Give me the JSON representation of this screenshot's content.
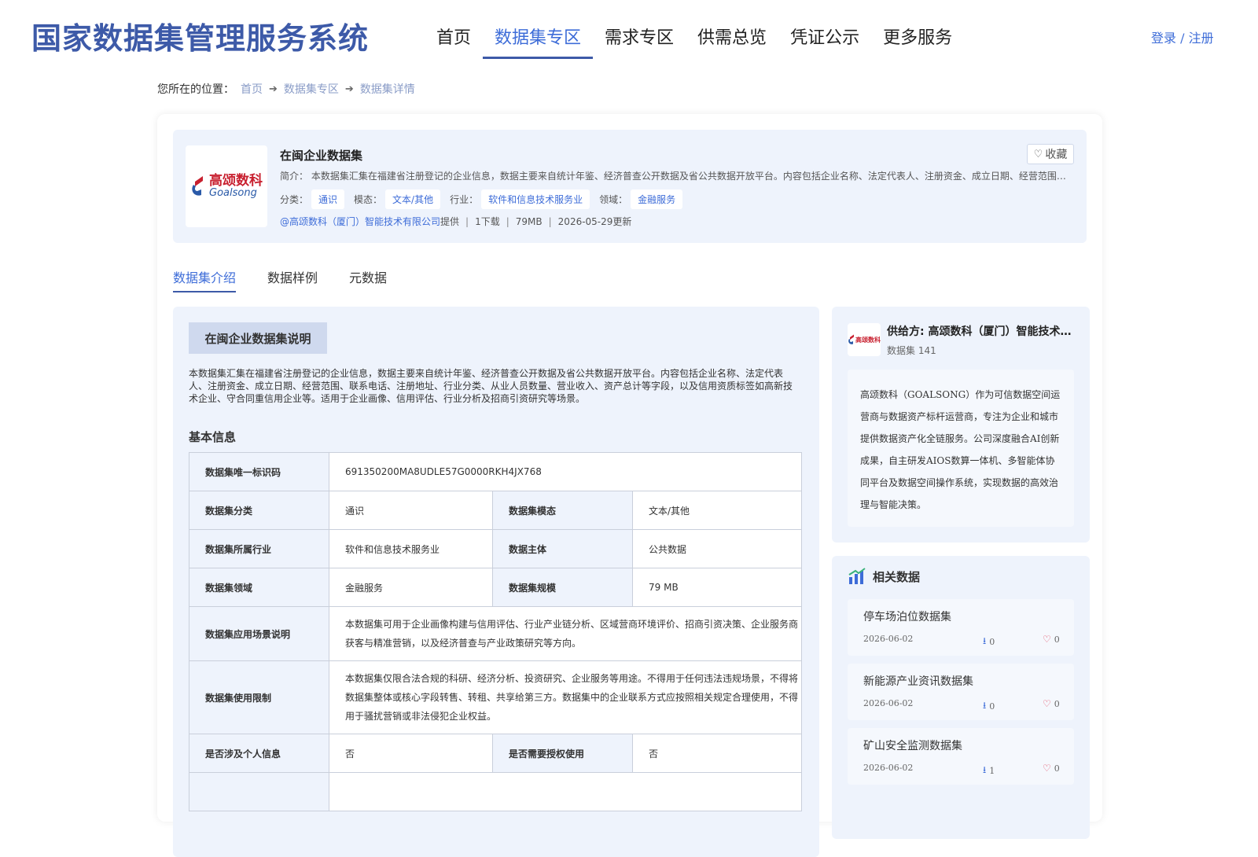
{
  "header": {
    "site_title": "国家数据集管理服务系统",
    "nav": [
      "首页",
      "数据集专区",
      "需求专区",
      "供需总览",
      "凭证公示",
      "更多服务"
    ],
    "active_nav": "数据集专区",
    "login": "登录 / 注册"
  },
  "breadcrumb": {
    "prefix": "您所在的位置：",
    "items": [
      "首页",
      "数据集专区",
      "数据集详情"
    ]
  },
  "summary": {
    "logo": {
      "cn": "高颂数科",
      "en": "Goalsong"
    },
    "title": "在闽企业数据集",
    "favorite_label": "收藏",
    "intro": "简介： 本数据集汇集在福建省注册登记的企业信息，数据主要来自统计年鉴、经济普查公开数据及省公共数据开放平台。内容包括企业名称、法定代表人、注册资金、成立日期、经营范围、联系电话、注册地址、行业分类、从业人员数量、营业收入、资产总计等字段",
    "tags": [
      {
        "label": "分类：",
        "value": "通识"
      },
      {
        "label": "模态：",
        "value": "文本/其他"
      },
      {
        "label": "行业：",
        "value": "软件和信息技术服务业"
      },
      {
        "label": "领域：",
        "value": "金融服务"
      }
    ],
    "provider_link": "@高颂数科（厦门）智能技术有限公司",
    "provider_suffix": "提供",
    "downloads": "1下载",
    "size": "79MB",
    "updated": "2026-05-29更新"
  },
  "tabs": [
    "数据集介绍",
    "数据样例",
    "元数据"
  ],
  "active_tab": "数据集介绍",
  "intro_section": {
    "heading": "在闽企业数据集说明",
    "description": "本数据集汇集在福建省注册登记的企业信息，数据主要来自统计年鉴、经济普查公开数据及省公共数据开放平台。内容包括企业名称、法定代表人、注册资金、成立日期、经营范围、联系电话、注册地址、行业分类、从业人员数量、营业收入、资产总计等字段，以及信用资质标签如高新技术企业、守合同重信用企业等。适用于企业画像、信用评估、行业分析及招商引资研究等场景。",
    "basic_title": "基本信息"
  },
  "basic_info": {
    "id_label": "数据集唯一标识码",
    "id_value": "691350200MA8UDLE57G0000RKH4JX768",
    "category_label": "数据集分类",
    "category_value": "通识",
    "modality_label": "数据集模态",
    "modality_value": "文本/其他",
    "industry_label": "数据集所属行业",
    "industry_value": "软件和信息技术服务业",
    "subject_label": "数据主体",
    "subject_value": "公共数据",
    "domain_label": "数据集领域",
    "domain_value": "金融服务",
    "scale_label": "数据集规模",
    "scale_value": "79 MB",
    "scenario_label": "数据集应用场景说明",
    "scenario_value": "本数据集可用于企业画像构建与信用评估、行业产业链分析、区域营商环境评价、招商引资决策、企业服务商获客与精准营销，以及经济普查与产业政策研究等方向。",
    "restriction_label": "数据集使用限制",
    "restriction_value": "本数据集仅限合法合规的科研、经济分析、投资研究、企业服务等用途。不得用于任何违法违规场景，不得将数据集整体或核心字段转售、转租、共享给第三方。数据集中的企业联系方式应按照相关规定合理使用，不得用于骚扰营销或非法侵犯企业权益。",
    "personal_label": "是否涉及个人信息",
    "personal_value": "否",
    "auth_label": "是否需要授权使用",
    "auth_value": "否"
  },
  "provider": {
    "logo_text": "高颂数科",
    "name": "供给方: 高颂数科（厦门）智能技术有限公司",
    "count": "数据集 141",
    "description": "高颂数科（GOALSONG）作为可信数据空间运营商与数据资产标杆运营商，专注为企业和城市提供数据资产化全链服务。公司深度融合AI创新成果，自主研发AIOS数算一体机、多智能体协同平台及数据空间操作系统，实现数据的高效治理与智能决策。"
  },
  "related": {
    "heading": "相关数据",
    "items": [
      {
        "title": "停车场泊位数据集",
        "date": "2026-06-02",
        "downloads": "0",
        "likes": "0"
      },
      {
        "title": "新能源产业资讯数据集",
        "date": "2026-06-02",
        "downloads": "0",
        "likes": "0"
      },
      {
        "title": "矿山安全监测数据集",
        "date": "2026-06-02",
        "downloads": "1",
        "likes": "0"
      }
    ]
  },
  "colors": {
    "brand": "#3d5aa8",
    "accent": "#3d6cd8",
    "panel": "#eef3fc",
    "like": "#e0405a"
  }
}
